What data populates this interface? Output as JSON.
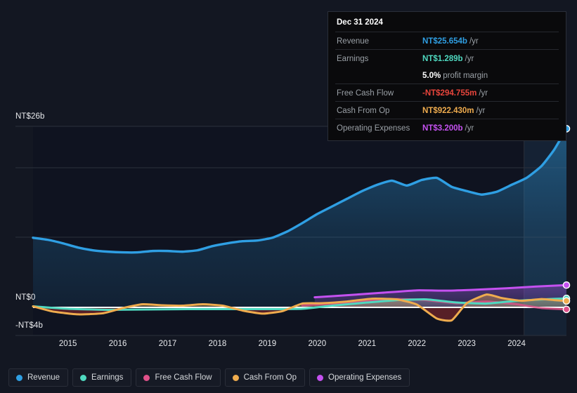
{
  "colors": {
    "background": "#131722",
    "revenue": "#2f9fe3",
    "earnings": "#4fd9c0",
    "free_cash_flow": "#e0518a",
    "cash_from_op": "#efac4e",
    "operating_expenses": "#c451f0",
    "zero_line": "#ffffff",
    "grid": "#2b303c",
    "negative_fill": "#5c2028"
  },
  "tooltip": {
    "date": "Dec 31 2024",
    "rows": [
      {
        "label": "Revenue",
        "value": "NT$25.654b",
        "unit": "/yr",
        "color": "#2f9fe3"
      },
      {
        "label": "Earnings",
        "value": "NT$1.289b",
        "unit": "/yr",
        "color": "#4fd9c0"
      },
      {
        "label": "",
        "value": "5.0%",
        "unit": "profit margin",
        "color": "#ffffff"
      },
      {
        "label": "Free Cash Flow",
        "value": "-NT$294.755m",
        "unit": "/yr",
        "color": "#e8453c"
      },
      {
        "label": "Cash From Op",
        "value": "NT$922.430m",
        "unit": "/yr",
        "color": "#efac4e"
      },
      {
        "label": "Operating Expenses",
        "value": "NT$3.200b",
        "unit": "/yr",
        "color": "#c451f0"
      }
    ]
  },
  "legend": {
    "items": [
      {
        "label": "Revenue",
        "color": "#2f9fe3"
      },
      {
        "label": "Earnings",
        "color": "#4fd9c0"
      },
      {
        "label": "Free Cash Flow",
        "color": "#e0518a"
      },
      {
        "label": "Cash From Op",
        "color": "#efac4e"
      },
      {
        "label": "Operating Expenses",
        "color": "#c451f0"
      }
    ]
  },
  "chart_data": {
    "type": "line",
    "title": "",
    "xlabel": "",
    "ylabel": "",
    "grid": true,
    "legend_position": "bottom",
    "ytick_labels": [
      "NT$26b",
      "NT$0",
      "-NT$4b"
    ],
    "ytick_values": [
      26,
      0,
      -4
    ],
    "ylim": [
      -4,
      26
    ],
    "xlim": [
      2014.3,
      2025.0
    ],
    "xtick_labels": [
      "2015",
      "2016",
      "2017",
      "2018",
      "2019",
      "2020",
      "2021",
      "2022",
      "2023",
      "2024"
    ],
    "xtick_values": [
      2015,
      2016,
      2017,
      2018,
      2019,
      2020,
      2021,
      2022,
      2023,
      2024
    ],
    "forecast_start": 2024.15,
    "currency_unit": "NT$ billions",
    "series": [
      {
        "name": "Revenue",
        "color": "#2f9fe3",
        "x": [
          2014.3,
          2014.6,
          2014.9,
          2015.2,
          2015.5,
          2015.8,
          2016.1,
          2016.4,
          2016.7,
          2017.0,
          2017.3,
          2017.6,
          2017.9,
          2018.2,
          2018.5,
          2018.8,
          2019.1,
          2019.4,
          2019.7,
          2020.0,
          2020.3,
          2020.6,
          2020.9,
          2021.2,
          2021.5,
          2021.8,
          2022.1,
          2022.4,
          2022.7,
          2023.0,
          2023.3,
          2023.6,
          2023.9,
          2024.2,
          2024.5,
          2024.75,
          2025.0
        ],
        "values": [
          10.0,
          9.7,
          9.2,
          8.6,
          8.2,
          8.0,
          7.9,
          7.9,
          8.1,
          8.1,
          8.0,
          8.2,
          8.8,
          9.2,
          9.5,
          9.6,
          10.0,
          10.9,
          12.1,
          13.4,
          14.5,
          15.6,
          16.7,
          17.6,
          18.2,
          17.5,
          18.3,
          18.6,
          17.3,
          16.7,
          16.2,
          16.6,
          17.6,
          18.6,
          20.3,
          22.6,
          25.654
        ]
      },
      {
        "name": "Earnings",
        "color": "#4fd9c0",
        "x": [
          2014.3,
          2015.0,
          2015.8,
          2016.6,
          2017.4,
          2018.2,
          2019.0,
          2019.7,
          2020.3,
          2021.0,
          2021.6,
          2022.2,
          2022.8,
          2023.4,
          2024.0,
          2024.5,
          2025.0
        ],
        "values": [
          0.15,
          -0.2,
          -0.35,
          -0.3,
          -0.25,
          -0.25,
          -0.25,
          -0.2,
          0.25,
          0.7,
          1.05,
          1.15,
          0.7,
          0.55,
          0.95,
          1.15,
          1.289
        ]
      },
      {
        "name": "Free Cash Flow",
        "color": "#e0518a",
        "x": [
          2019.7,
          2020.3,
          2021.0,
          2021.6,
          2022.2,
          2022.8,
          2023.4,
          2024.0,
          2024.5,
          2025.0
        ],
        "values": [
          0.3,
          0.55,
          0.95,
          1.2,
          1.05,
          0.6,
          0.85,
          0.45,
          -0.1,
          -0.294755
        ]
      },
      {
        "name": "Cash From Op",
        "color": "#efac4e",
        "x": [
          2014.3,
          2014.7,
          2015.2,
          2015.7,
          2016.1,
          2016.5,
          2016.9,
          2017.3,
          2017.7,
          2018.1,
          2018.5,
          2018.9,
          2019.3,
          2019.7,
          2020.1,
          2020.6,
          2021.1,
          2021.6,
          2022.0,
          2022.4,
          2022.7,
          2023.0,
          2023.4,
          2023.7,
          2024.1,
          2024.5,
          2024.75,
          2025.0
        ],
        "values": [
          0.15,
          -0.6,
          -1.0,
          -0.85,
          -0.1,
          0.45,
          0.3,
          0.25,
          0.45,
          0.25,
          -0.45,
          -0.9,
          -0.55,
          0.55,
          0.6,
          0.85,
          1.25,
          1.15,
          0.4,
          -1.6,
          -1.85,
          0.6,
          1.85,
          1.35,
          0.95,
          1.2,
          1.05,
          0.92243
        ]
      },
      {
        "name": "Operating Expenses",
        "color": "#c451f0",
        "x": [
          2019.95,
          2020.6,
          2021.3,
          2022.0,
          2022.6,
          2023.2,
          2023.8,
          2024.4,
          2025.0
        ],
        "values": [
          1.45,
          1.75,
          2.1,
          2.45,
          2.4,
          2.55,
          2.75,
          3.0,
          3.2
        ]
      }
    ]
  }
}
